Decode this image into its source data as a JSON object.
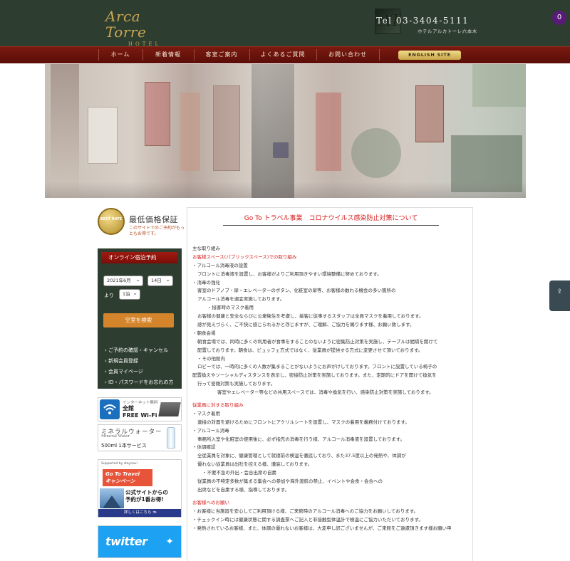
{
  "header": {
    "logo_script": "Arca Torre",
    "logo_sub": "HOTEL",
    "tel_mark": "AT",
    "tel": "Tel 03-3404-5111",
    "hotel_name": "ホテルアルカトーレ六本木",
    "cart_count": "0"
  },
  "nav": {
    "items": [
      "ホーム",
      "新着情報",
      "客室ご案内",
      "よくあるご質問",
      "お問い合わせ"
    ],
    "english": "ENGLISH SITE"
  },
  "sidebar": {
    "best_rate": {
      "seal": "BEST RATE",
      "title": "最低価格保証",
      "sub": "このサイトでのご予約がもっともお得です。"
    },
    "booking": {
      "title": "オンライン宿泊予約",
      "month": "2021年6月",
      "day": "14日",
      "from_label": "より",
      "nights": "1泊",
      "search": "空室を検索",
      "links": [
        "ご予約の確認・キャンセル",
        "新規会員登録",
        "会員マイページ",
        "ID・パスワードをお忘れの方"
      ]
    },
    "wifi": {
      "small": "インターネット無料",
      "line1": "全館",
      "line2": "FREE Wi-Fi"
    },
    "water": {
      "jp": "ミネラルウォーター",
      "en": "Mineral Water",
      "service": "500ml 1本サービス"
    },
    "gototravel": {
      "top": "Supported by staynavi",
      "head1": "Go To Travel",
      "head2": "キャンペーン",
      "main1": "公式サイトからの",
      "main2": "予約が1番お得!",
      "bar": "詳しくはこちら ≫"
    },
    "twitter": {
      "label": "twitter"
    }
  },
  "main": {
    "title": "Go To トラベル事業　コロナウイルス感染防止対策について",
    "lines": [
      {
        "t": "主な取り組み",
        "c": "",
        "i": 0
      },
      {
        "t": "お客様スペース(パブリックスペース)での取り組み",
        "c": "red",
        "i": 0
      },
      {
        "t": "・アルコール消毒液の設置",
        "c": "",
        "i": 0
      },
      {
        "t": "フロントに消毒液を設置し、お客様がよりご利用頂きやすい環境整備に努めております。",
        "c": "",
        "i": 1
      },
      {
        "t": "・消毒の強化",
        "c": "",
        "i": 0
      },
      {
        "t": "客室のドアノブ・扉・エレベーターのボタン、化粧室の扉等、お客様の触れる機会の多い箇所の",
        "c": "",
        "i": 1
      },
      {
        "t": "アルコール消毒を適宜実施しております。",
        "c": "",
        "i": 1
      },
      {
        "t": "・接客時のマスク着用",
        "c": "",
        "i": 3
      },
      {
        "t": "お客様の健康と安全ならびに公衆衛生を考慮し、接客に従事するスタッフは全員マスクを着用しております。",
        "c": "",
        "i": 1
      },
      {
        "t": "感が見えづらく、ご不快に感じられるかと存じますが、ご理解、ご協力を賜ります様、お願い致します。",
        "c": "",
        "i": 1
      },
      {
        "t": "・朝食会場",
        "c": "",
        "i": 0
      },
      {
        "t": "朝食会場では、同時に多くの利用者が食事をすることのないように密集防止対策を実施し、テーブルは間隔を開けて",
        "c": "",
        "i": 1
      },
      {
        "t": "配置しております。朝食は、ビュッフェ方式ではなく、従業員が提供する方式に変更させて頂いております。",
        "c": "",
        "i": 1
      },
      {
        "t": "・その他館内",
        "c": "",
        "i": 1
      },
      {
        "t": "ロビーでは、一時的に多くの人数が集まることがないようにお声がけしております。フロントに設置している椅子の",
        "c": "",
        "i": 1
      },
      {
        "t": "配置換えやソーシャルディスタンスを表示し、密接防止対策を実施しております。また、定期的にドアを開けて換気を",
        "c": "",
        "i": 0
      },
      {
        "t": "行って密閉対策も実施しております。",
        "c": "",
        "i": 1
      },
      {
        "t": "客室やエレベーター等などの共用スペースでは、消毒や換気を行い、感染防止対策を実施しております。",
        "c": "",
        "i": 4
      },
      {
        "t": "",
        "c": "gap",
        "i": 0
      },
      {
        "t": "従業員に対する取り組み",
        "c": "red",
        "i": 0
      },
      {
        "t": "・マスク着用",
        "c": "",
        "i": 0
      },
      {
        "t": "連接の対面を避けるためにフロントにアクリルシートを設置し、マスクの着用を義務付けております。",
        "c": "",
        "i": 1
      },
      {
        "t": "・アルコール消毒",
        "c": "",
        "i": 0
      },
      {
        "t": "事務所入室や化粧室の使用後に、必ず指先の消毒を行う様、アルコール消毒液を設置しております。",
        "c": "",
        "i": 1
      },
      {
        "t": "・体調確認",
        "c": "",
        "i": 0
      },
      {
        "t": "全従業員を対象に、健康管理として就寝前の検温を徹底しており、また37.5度以上の発熱や、体調が",
        "c": "",
        "i": 1
      },
      {
        "t": "優れない従業員は出社を控える様、徹底しております。",
        "c": "",
        "i": 1
      },
      {
        "t": "・不要不急の外出・会合出席の自粛",
        "c": "",
        "i": 2
      },
      {
        "t": "従業員の不特定多数が集まる集会への参加や海外渡航の禁止、イベントや会食・会合への",
        "c": "",
        "i": 1
      },
      {
        "t": "出席などを自粛する様、指導しております。",
        "c": "",
        "i": 1
      },
      {
        "t": "",
        "c": "gap",
        "i": 0
      },
      {
        "t": "お客様へのお願い",
        "c": "red",
        "i": 0
      },
      {
        "t": "・お客様に当施設を安心してご利用頂ける様、ご来館時のアルコール消毒へのご協力をお願いしております。",
        "c": "",
        "i": 0
      },
      {
        "t": "・チェックイン時には健康状態に関する調査票へご記入と非接触型体温計で検温にご協力いただいております。",
        "c": "",
        "i": 0
      },
      {
        "t": "・発熱されているお客様、また、体調の優れないお客様は、大変申し訳ございませんが、ご来館をご遠慮頂きます様お願い申",
        "c": "",
        "i": 0
      }
    ]
  },
  "side_tab": {
    "label": "⇪"
  }
}
